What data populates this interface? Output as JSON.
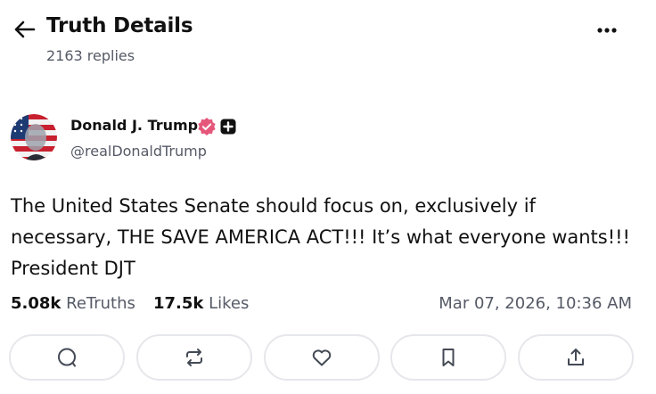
{
  "header": {
    "title": "Truth Details",
    "replies": "2163 replies",
    "back_icon": "arrow-left-icon",
    "more_icon": "more-horizontal-icon"
  },
  "author": {
    "name": "Donald J. Trump",
    "handle": "@realDonaldTrump",
    "verified_icon": "verified-badge-icon",
    "plus_icon": "plus-badge-icon"
  },
  "post": {
    "text": "The United States Senate should focus on, exclusively if\nnecessary, THE SAVE AMERICA ACT!!! It’s what everyone wants!!!\nPresident DJT"
  },
  "stats": {
    "retruths_count": "5.08k",
    "retruths_label": "ReTruths",
    "likes_count": "17.5k",
    "likes_label": "Likes",
    "timestamp": "Mar 07, 2026, 10:36 AM"
  },
  "actions": [
    {
      "icon": "reply-icon"
    },
    {
      "icon": "retruth-icon"
    },
    {
      "icon": "like-icon"
    },
    {
      "icon": "bookmark-icon"
    },
    {
      "icon": "share-icon"
    }
  ],
  "colors": {
    "text": "#111111",
    "muted": "#555a66",
    "verified": "#e5577a",
    "border": "#e6e7eb"
  }
}
